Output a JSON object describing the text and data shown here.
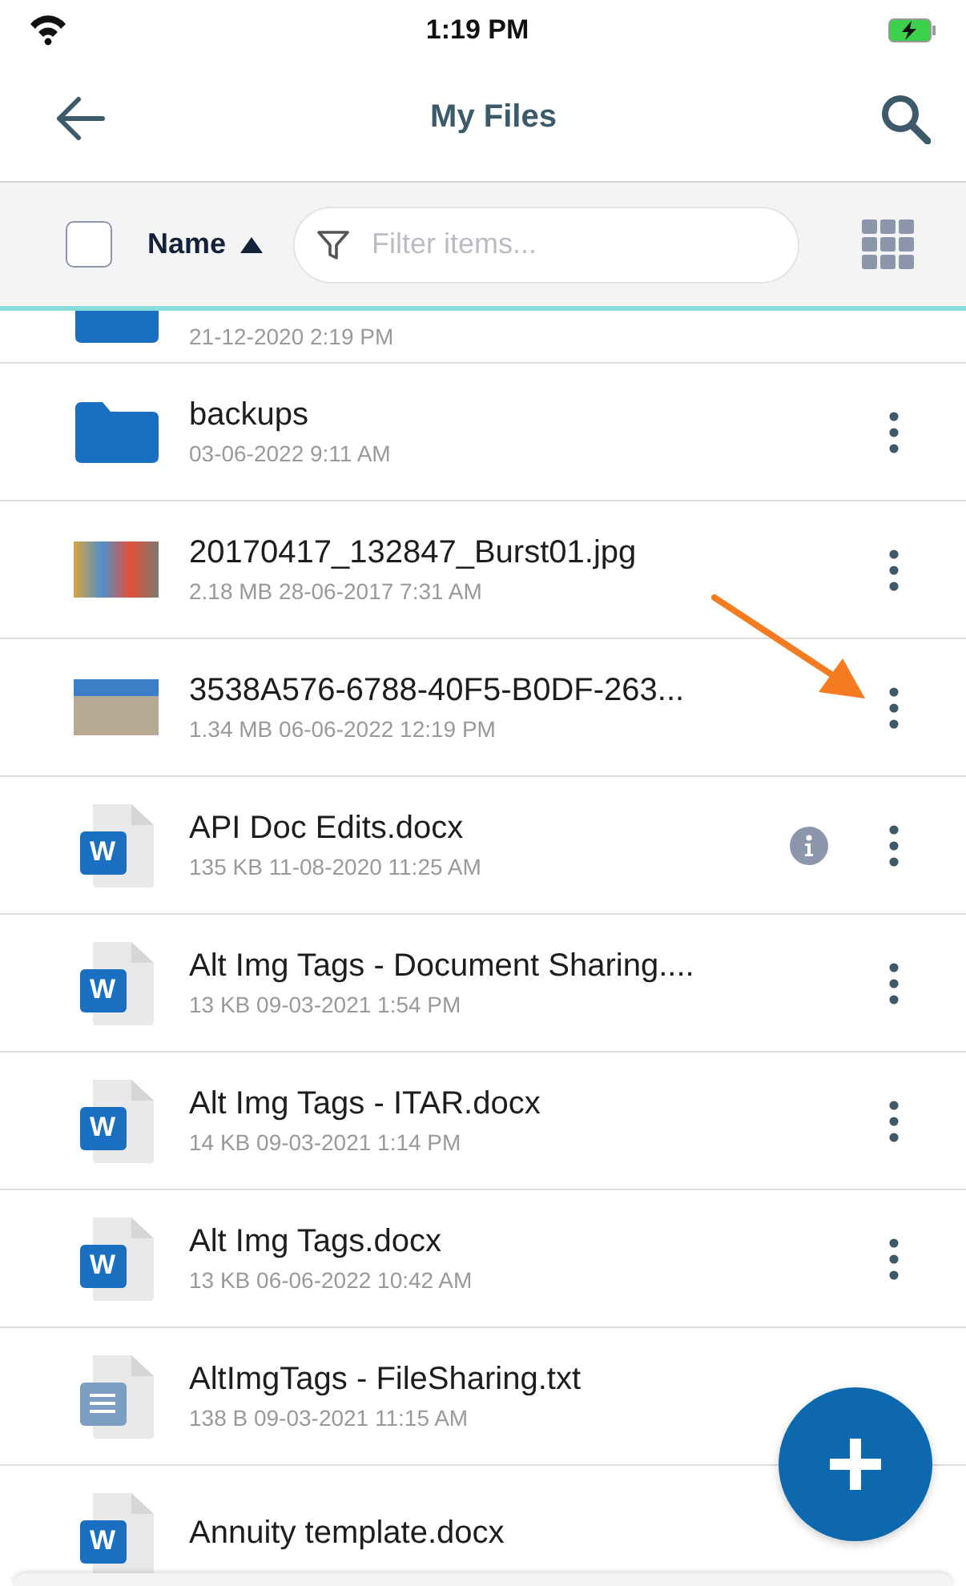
{
  "status_bar": {
    "time": "1:19 PM"
  },
  "nav": {
    "title": "My Files"
  },
  "toolbar": {
    "select_all": {
      "checked": false
    },
    "sort": {
      "label": "Name",
      "ascending": true
    },
    "filter": {
      "placeholder": "Filter items..."
    }
  },
  "files": [
    {
      "kind": "folder",
      "meta": "21-12-2020 2:19 PM",
      "info": false,
      "menu": false
    },
    {
      "kind": "folder",
      "name": "backups",
      "meta": "03-06-2022 9:11 AM",
      "info": false,
      "menu": true
    },
    {
      "kind": "image",
      "name": "20170417_132847_Burst01.jpg",
      "meta": "2.18 MB 28-06-2017 7:31 AM",
      "info": false,
      "menu": true
    },
    {
      "kind": "image",
      "name": "3538A576-6788-40F5-B0DF-263...",
      "meta": "1.34 MB 06-06-2022 12:19 PM",
      "info": false,
      "menu": true
    },
    {
      "kind": "word",
      "badge": "W",
      "name": "API Doc Edits.docx",
      "meta": "135 KB 11-08-2020 11:25 AM",
      "info": true,
      "menu": true
    },
    {
      "kind": "word",
      "badge": "W",
      "name": "Alt Img Tags - Document Sharing....",
      "meta": "13 KB 09-03-2021 1:54 PM",
      "info": false,
      "menu": true
    },
    {
      "kind": "word",
      "badge": "W",
      "name": "Alt Img Tags - ITAR.docx",
      "meta": "14 KB 09-03-2021 1:14 PM",
      "info": false,
      "menu": true
    },
    {
      "kind": "word",
      "badge": "W",
      "name": "Alt Img Tags.docx",
      "meta": "13 KB 06-06-2022 10:42 AM",
      "info": false,
      "menu": true
    },
    {
      "kind": "text",
      "name": "AltImgTags - FileSharing.txt",
      "meta": "138 B 09-03-2021 11:15 AM",
      "info": false,
      "menu": false
    },
    {
      "kind": "word",
      "badge": "W",
      "name": "Annuity template.docx",
      "info": false,
      "menu": false
    }
  ]
}
